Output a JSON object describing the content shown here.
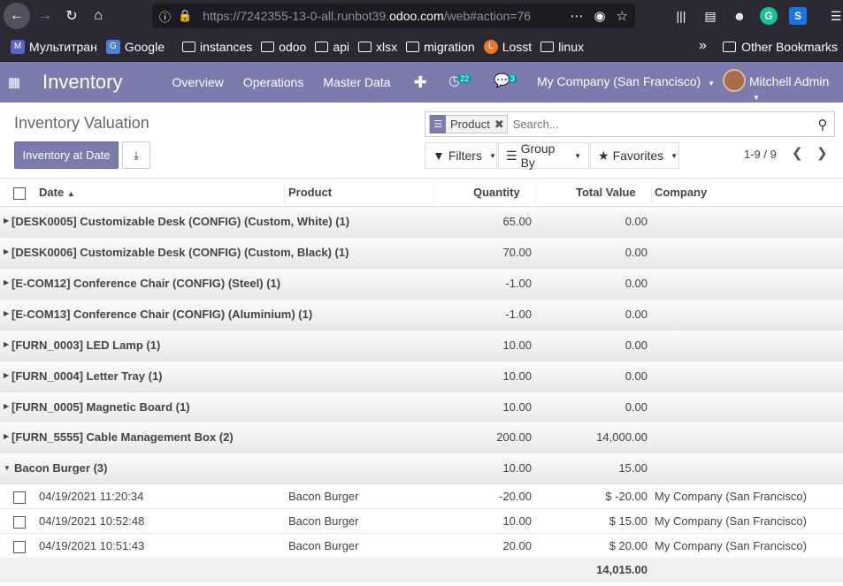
{
  "browser": {
    "url_prefix": "https://7242355-13-0-all.runbot39.",
    "url_host": "odoo.com",
    "url_suffix": "/web#action=76"
  },
  "bookmarks": [
    {
      "label": "Мультитран",
      "icon": "multitran-icon"
    },
    {
      "label": "Google",
      "icon": "google-icon"
    },
    {
      "label": "instances",
      "icon": "folder-icon"
    },
    {
      "label": "odoo",
      "icon": "folder-icon"
    },
    {
      "label": "api",
      "icon": "folder-icon"
    },
    {
      "label": "xlsx",
      "icon": "folder-icon"
    },
    {
      "label": "migration",
      "icon": "folder-icon"
    },
    {
      "label": "Losst",
      "icon": "losst-icon"
    },
    {
      "label": "linux",
      "icon": "folder-icon"
    }
  ],
  "other_bookmarks": "Other Bookmarks",
  "navbar": {
    "app_title": "Inventory",
    "menu": [
      "Overview",
      "Operations",
      "Master Data"
    ],
    "activity_count": "22",
    "message_count": "3",
    "company": "My Company (San Francisco)",
    "user": "Mitchell Admin"
  },
  "control_panel": {
    "breadcrumb": "Inventory Valuation",
    "primary_button": "Inventory at Date",
    "facet_value": "Product",
    "search_placeholder": "Search...",
    "filters_label": "Filters",
    "groupby_label": "Group By",
    "favorites_label": "Favorites",
    "pager": "1-9 / 9"
  },
  "table": {
    "columns": [
      "Date",
      "Product",
      "Quantity",
      "Total Value",
      "Company"
    ],
    "groups": [
      {
        "name": "[DESK0005] Customizable Desk (CONFIG) (Custom, White) (1)",
        "qty": "65.00",
        "value": "0.00"
      },
      {
        "name": "[DESK0006] Customizable Desk (CONFIG) (Custom, Black) (1)",
        "qty": "70.00",
        "value": "0.00"
      },
      {
        "name": "[E-COM12] Conference Chair (CONFIG) (Steel) (1)",
        "qty": "-1.00",
        "value": "0.00"
      },
      {
        "name": "[E-COM13] Conference Chair (CONFIG) (Aluminium) (1)",
        "qty": "-1.00",
        "value": "0.00"
      },
      {
        "name": "[FURN_0003] LED Lamp (1)",
        "qty": "10.00",
        "value": "0.00"
      },
      {
        "name": "[FURN_0004] Letter Tray (1)",
        "qty": "10.00",
        "value": "0.00"
      },
      {
        "name": "[FURN_0005] Magnetic Board (1)",
        "qty": "10.00",
        "value": "0.00"
      },
      {
        "name": "[FURN_5555] Cable Management Box (2)",
        "qty": "200.00",
        "value": "14,000.00"
      },
      {
        "name": "Bacon Burger (3)",
        "qty": "10.00",
        "value": "15.00"
      }
    ],
    "rows": [
      {
        "date": "04/19/2021 11:20:34",
        "product": "Bacon Burger",
        "qty": "-20.00",
        "value": "$ -20.00",
        "company": "My Company (San Francisco)"
      },
      {
        "date": "04/19/2021 10:52:48",
        "product": "Bacon Burger",
        "qty": "10.00",
        "value": "$ 15.00",
        "company": "My Company (San Francisco)"
      },
      {
        "date": "04/19/2021 10:51:43",
        "product": "Bacon Burger",
        "qty": "20.00",
        "value": "$ 20.00",
        "company": "My Company (San Francisco)"
      }
    ],
    "total_value": "14,015.00"
  }
}
